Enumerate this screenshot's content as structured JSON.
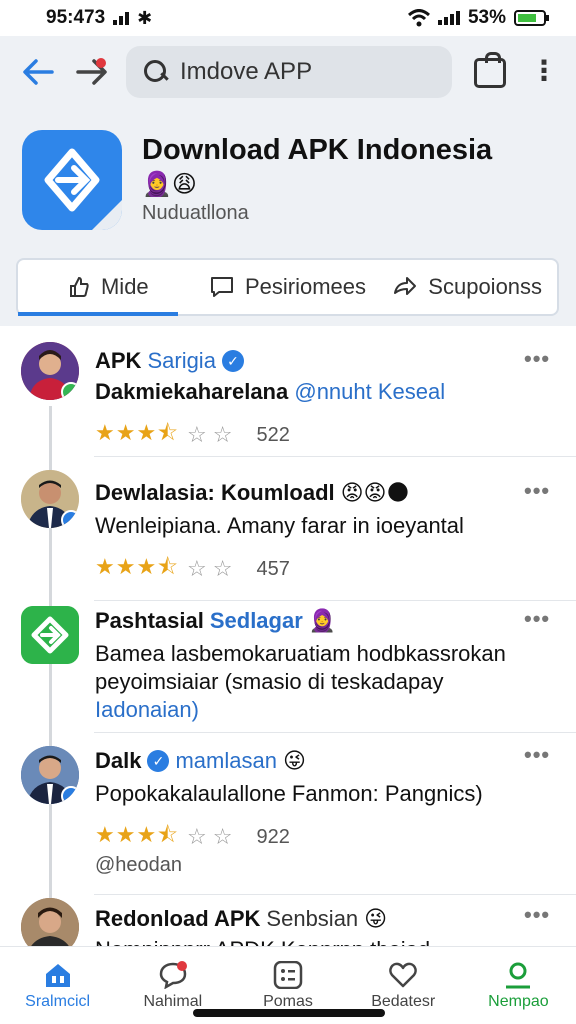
{
  "status": {
    "time": "95:473",
    "battery": "53%"
  },
  "search": {
    "placeholder": "Imdove APP"
  },
  "app": {
    "title": "Download APK Indonesia",
    "subtitle": "Nuduatllona",
    "emoji": "🧕😩"
  },
  "tabs": [
    {
      "label": "Mide",
      "icon": "thumb-icon"
    },
    {
      "label": "Pesiriomees",
      "icon": "chat-icon"
    },
    {
      "label": "Scupoionss",
      "icon": "share-icon"
    }
  ],
  "posts": [
    {
      "name": "APK",
      "name_blue": "Sarigia",
      "text": "Dakmiekaharelana",
      "text_blue": "@nnuht Keseal",
      "count": "522",
      "rating": 3.5
    },
    {
      "name": "Dewlalasia: Koumloadl",
      "emoji": "😡😡🌑",
      "text": "Wenleipiana. Amany farar in ioeyantal",
      "count": "457",
      "rating": 3.5
    },
    {
      "name": "Pashtasial",
      "name_blue": "Sedlagar",
      "emoji": "🧕",
      "text": "Bamea lasbemokaruatiam hodbkassrokan peyoimsiaiar (smasio di teskadapay",
      "text_blue": "Iadonaian)"
    },
    {
      "name": "Dalk",
      "name_blue": "mamlasan",
      "emoji": "😜",
      "text": "Popokakalaulallone Fanmon: Pangnics)",
      "count": "922",
      "handle": "@heodan",
      "rating": 3.5
    },
    {
      "name": "Redonload APK",
      "name_gray": "Senbsian",
      "emoji": "😜",
      "text": "Nemnipnnrr APDK Kennrnp theiad"
    }
  ],
  "nav": [
    {
      "label": "Sralmcicl"
    },
    {
      "label": "Nahimal"
    },
    {
      "label": "Pomas"
    },
    {
      "label": "Bedatesr"
    },
    {
      "label": "Nempao"
    }
  ]
}
